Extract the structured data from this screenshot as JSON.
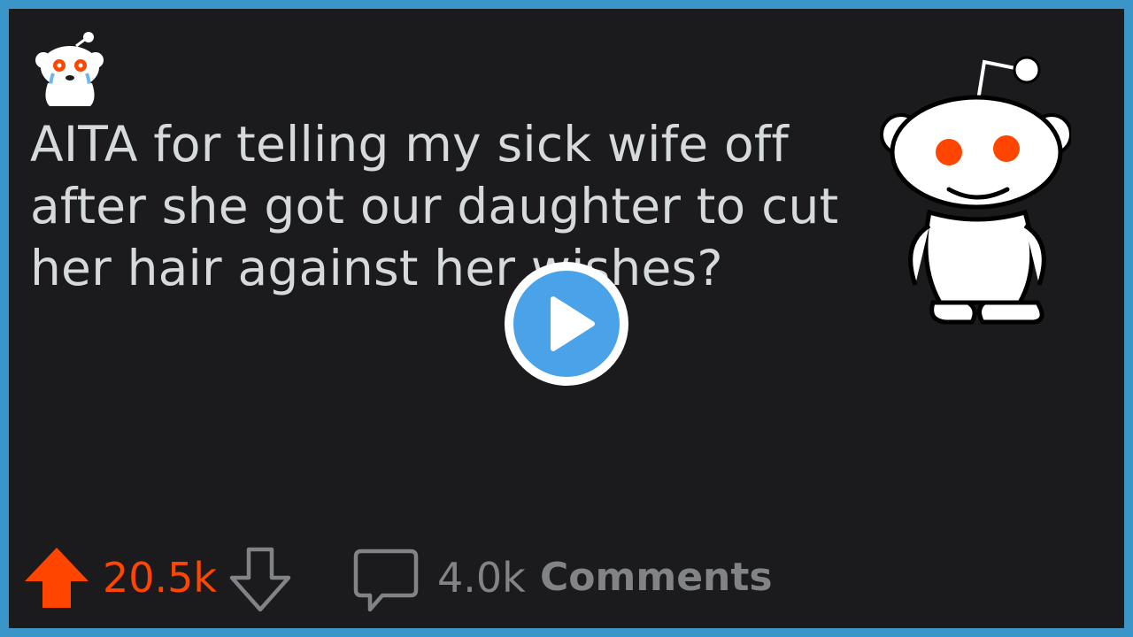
{
  "post": {
    "title": "AITA for telling my sick wife off after she got our daughter to cut her hair against her wishes?"
  },
  "actions": {
    "score": "20.5k",
    "comments_count": "4.0k",
    "comments_label": "Comments"
  },
  "icons": {
    "avatar": "reddit-avatar-icon",
    "mascot": "reddit-snoo-icon",
    "play": "play-icon",
    "upvote": "upvote-arrow-icon",
    "downvote": "downvote-arrow-icon",
    "comment": "comment-bubble-icon"
  },
  "colors": {
    "border": "#3a95c9",
    "background": "#1b1b1d",
    "title_text": "#d7dadc",
    "upvote": "#ff4500",
    "muted": "#818384",
    "play_button": "#4aa3e8"
  }
}
